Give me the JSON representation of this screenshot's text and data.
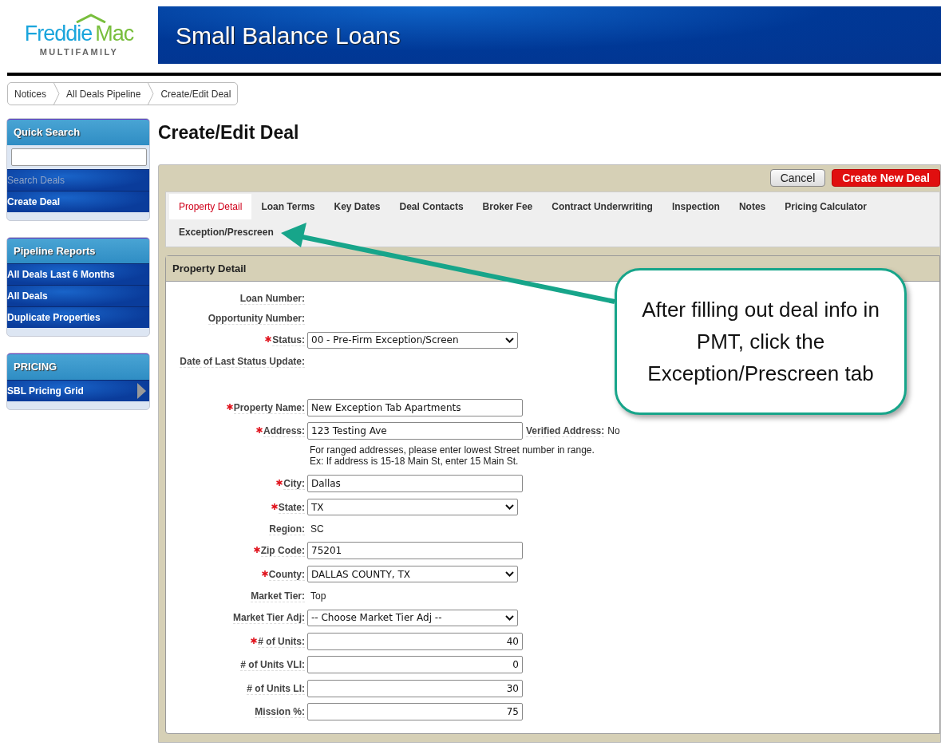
{
  "logo": {
    "word1": "Freddie",
    "word2": "Mac",
    "sub": "MULTIFAMILY"
  },
  "banner": {
    "title": "Small Balance Loans"
  },
  "breadcrumb": [
    "Notices",
    "All Deals Pipeline",
    "Create/Edit Deal"
  ],
  "sidebar": [
    {
      "title": "Quick Search",
      "search": true,
      "items": [
        {
          "label": "Search Deals",
          "disabled": true,
          "expandable": false
        },
        {
          "label": "Create Deal",
          "disabled": false,
          "expandable": false
        }
      ]
    },
    {
      "title": "Pipeline Reports",
      "search": false,
      "items": [
        {
          "label": "All Deals Last 6 Months",
          "disabled": false,
          "expandable": false
        },
        {
          "label": "All Deals",
          "disabled": false,
          "expandable": false
        },
        {
          "label": "Duplicate Properties",
          "disabled": false,
          "expandable": false
        }
      ]
    },
    {
      "title": "PRICING",
      "search": false,
      "items": [
        {
          "label": "SBL Pricing Grid",
          "disabled": false,
          "expandable": true
        }
      ]
    }
  ],
  "page_title": "Create/Edit Deal",
  "buttons": [
    {
      "label": "Cancel",
      "kind": "secondary"
    },
    {
      "label": "Create New Deal",
      "kind": "primary"
    }
  ],
  "tabs": [
    {
      "label": "Property Detail",
      "selected": true
    },
    {
      "label": "Loan Terms",
      "selected": false
    },
    {
      "label": "Key Dates",
      "selected": false
    },
    {
      "label": "Deal Contacts",
      "selected": false
    },
    {
      "label": "Broker Fee",
      "selected": false
    },
    {
      "label": "Contract Underwriting",
      "selected": false
    },
    {
      "label": "Inspection",
      "selected": false
    },
    {
      "label": "Notes",
      "selected": false
    },
    {
      "label": "Pricing Calculator",
      "selected": false
    },
    {
      "label": "Exception/Prescreen",
      "selected": false
    }
  ],
  "panel": {
    "title": "Property Detail",
    "status_fields": [
      {
        "label": "Loan Number:",
        "kind": "static",
        "required": false
      },
      {
        "label": "Opportunity Number:",
        "kind": "static",
        "required": false
      },
      {
        "label": "Status:",
        "kind": "select",
        "required": true,
        "value": "00 - Pre-Firm Exception/Screen"
      },
      {
        "label": "Date of Last Status Update:",
        "kind": "static",
        "required": false
      }
    ],
    "property_fields": [
      {
        "label": "Property Name:",
        "kind": "input",
        "required": true,
        "value": "New Exception Tab Apartments"
      },
      {
        "label": "Address:",
        "kind": "input",
        "required": true,
        "value": "123 Testing Ave",
        "extra": {
          "label": "Verified Address:",
          "value": "No"
        },
        "note": [
          "For ranged addresses, please enter lowest Street number in range.",
          "Ex: If address is 15-18 Main St, enter 15 Main St."
        ]
      },
      {
        "label": "City:",
        "kind": "input",
        "required": true,
        "value": "Dallas"
      },
      {
        "label": "State:",
        "kind": "select",
        "required": true,
        "value": "TX"
      },
      {
        "label": "Region:",
        "kind": "static",
        "required": false,
        "value": "SC"
      },
      {
        "label": "Zip Code:",
        "kind": "input",
        "required": true,
        "value": "75201"
      },
      {
        "label": "County:",
        "kind": "select",
        "required": true,
        "value": "DALLAS COUNTY, TX"
      },
      {
        "label": "Market Tier:",
        "kind": "static",
        "required": false,
        "value": "Top"
      },
      {
        "label": "Market Tier Adj:",
        "kind": "select",
        "required": false,
        "value": "-- Choose Market Tier Adj --"
      },
      {
        "label": "# of Units:",
        "kind": "number",
        "required": true,
        "value": "40"
      },
      {
        "label": "# of Units VLI:",
        "kind": "number",
        "required": false,
        "value": "0"
      },
      {
        "label": "# of Units LI:",
        "kind": "number",
        "required": false,
        "value": "30"
      },
      {
        "label": "Mission %:",
        "kind": "number",
        "required": false,
        "value": "75"
      }
    ]
  },
  "callout": {
    "text": "After filling out deal info in PMT, click the Exception/Prescreen tab"
  }
}
